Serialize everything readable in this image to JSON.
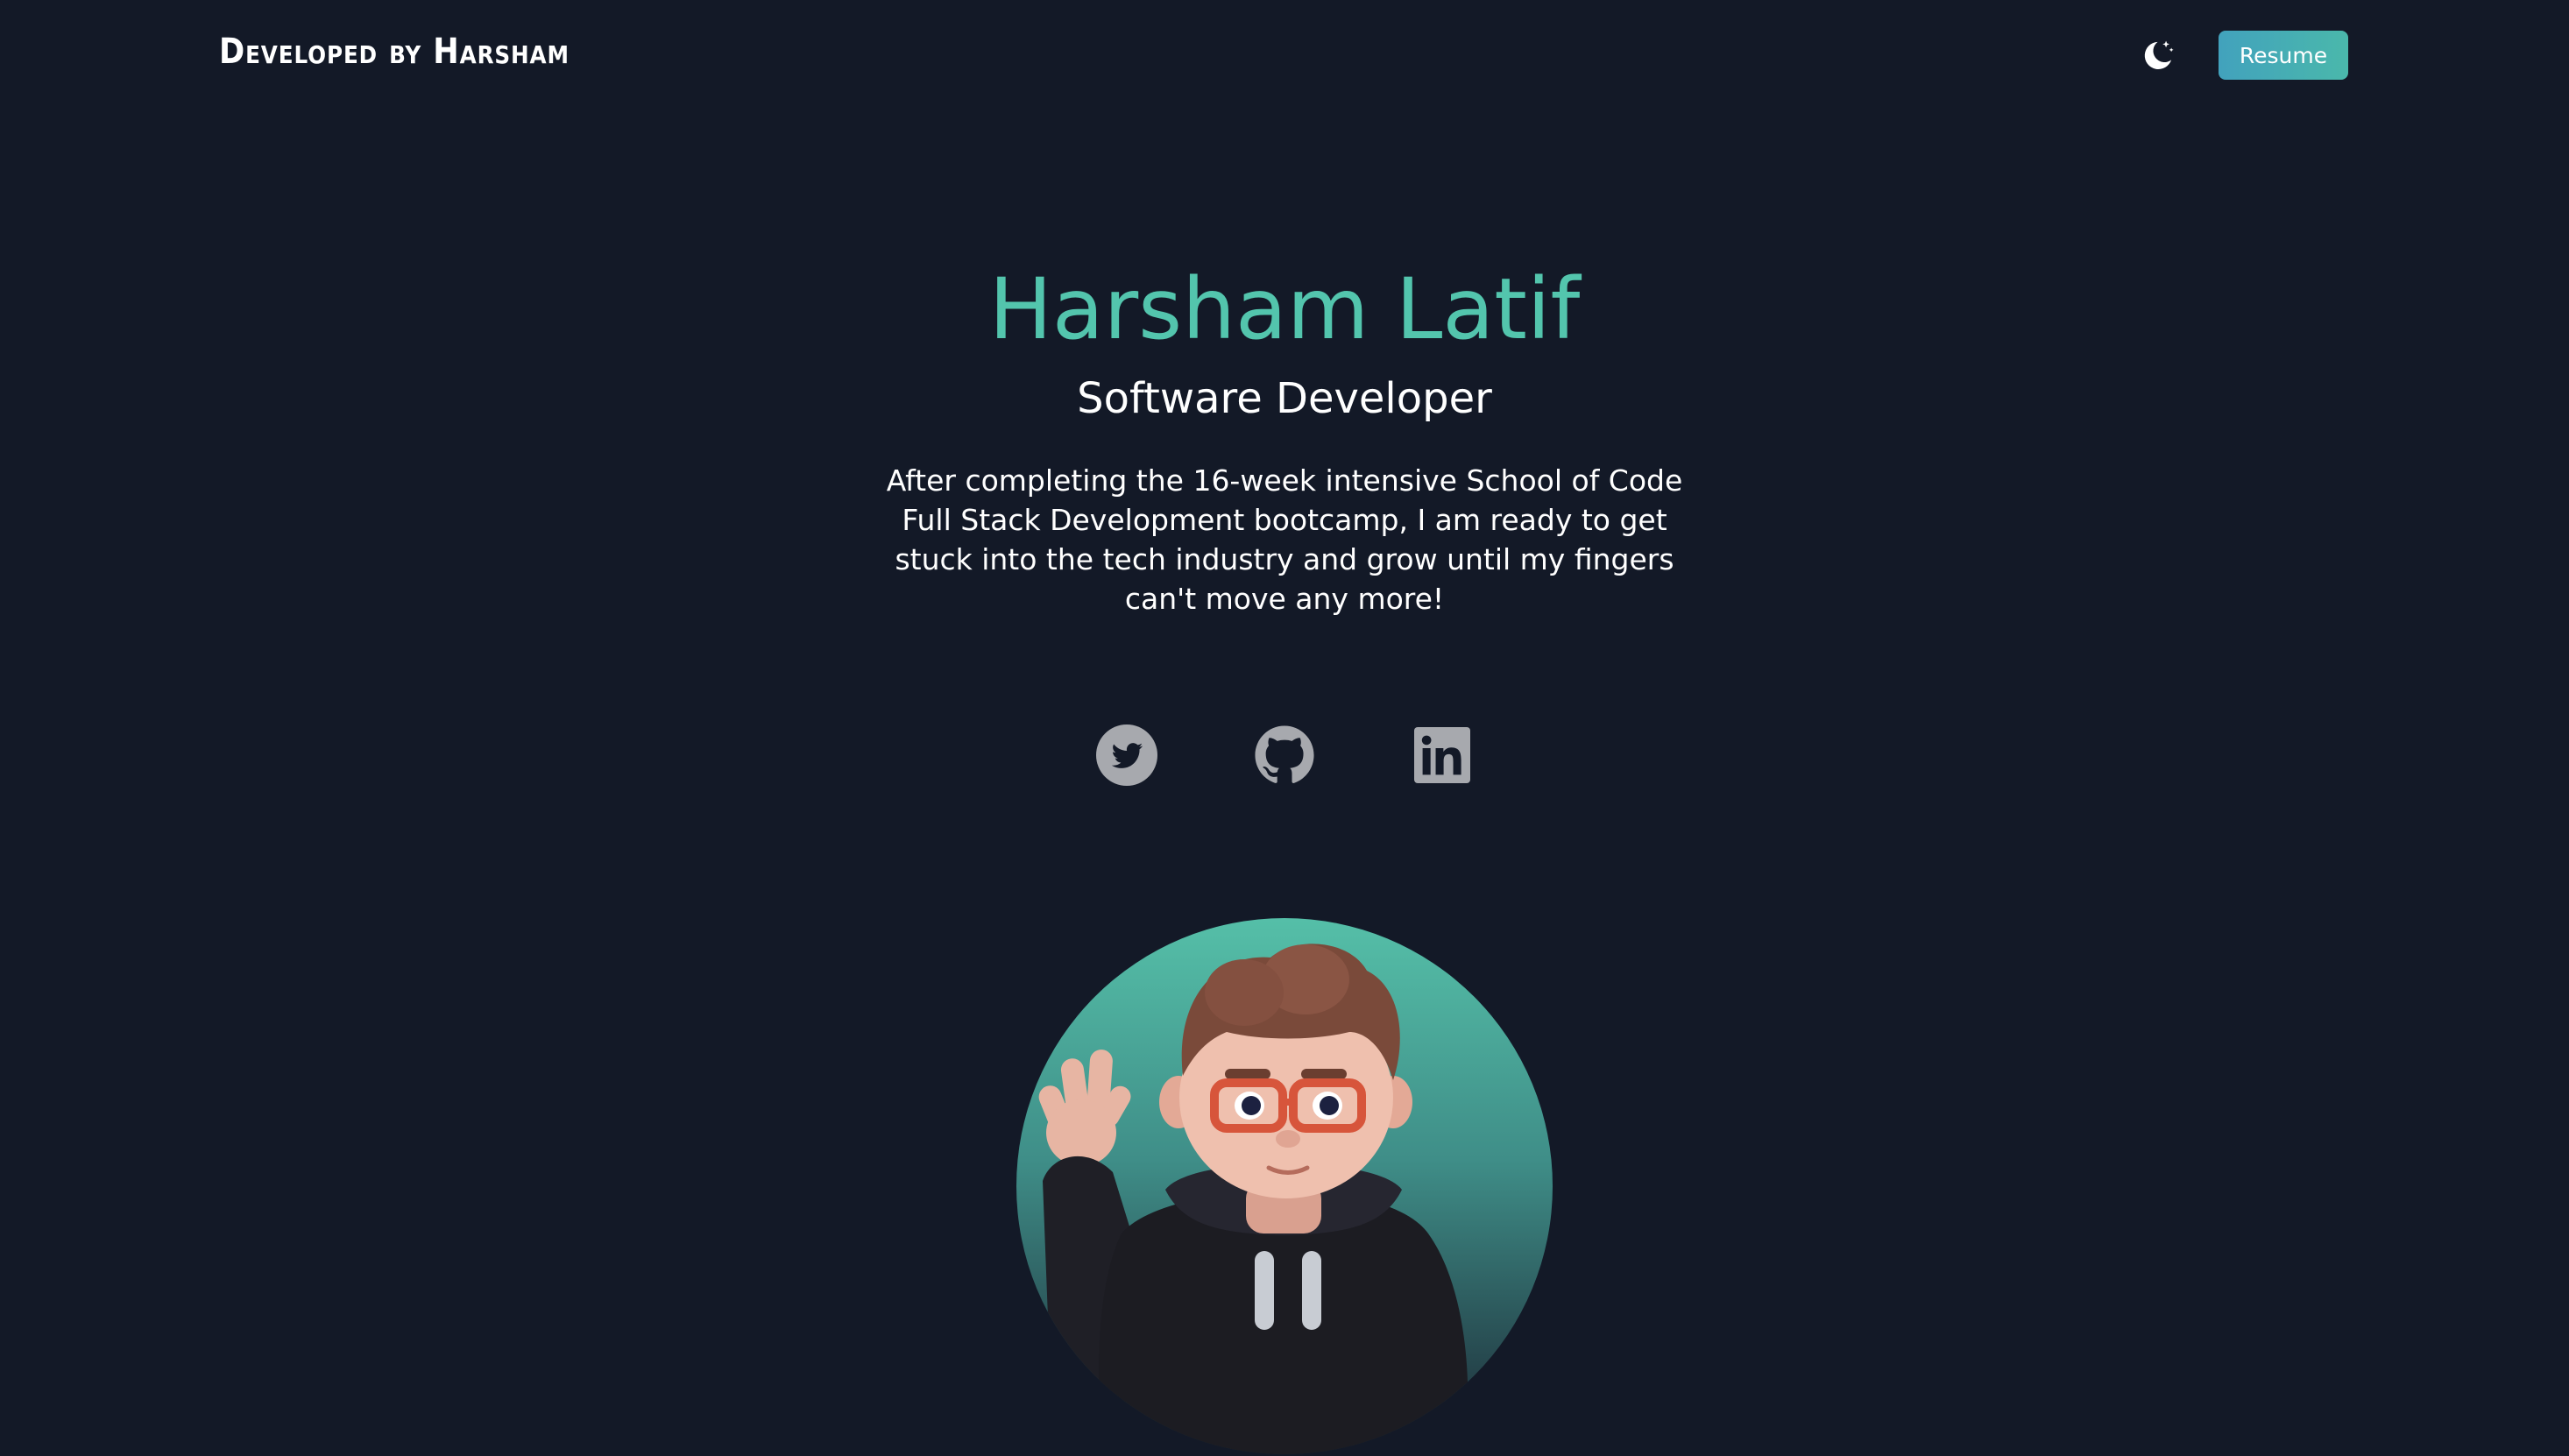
{
  "header": {
    "brand": "Developed by Harsham",
    "theme_toggle_icon": "moon-stars-icon",
    "resume_label": "Resume"
  },
  "hero": {
    "name": "Harsham Latif",
    "role": "Software Developer",
    "bio": "After completing the 16-week intensive School of Code Full Stack Development bootcamp, I am ready to get stuck into the tech industry and grow until my fingers can't move any more!"
  },
  "socials": [
    {
      "icon": "twitter-icon"
    },
    {
      "icon": "github-icon"
    },
    {
      "icon": "linkedin-icon"
    }
  ],
  "avatar": {
    "icon": "avatar-illustration"
  },
  "colors": {
    "background": "#131927",
    "accent": "#53c5ad",
    "button_gradient_start": "#42a2bd",
    "button_gradient_end": "#4ab8ab",
    "social_icon": "#a7a9ae"
  }
}
